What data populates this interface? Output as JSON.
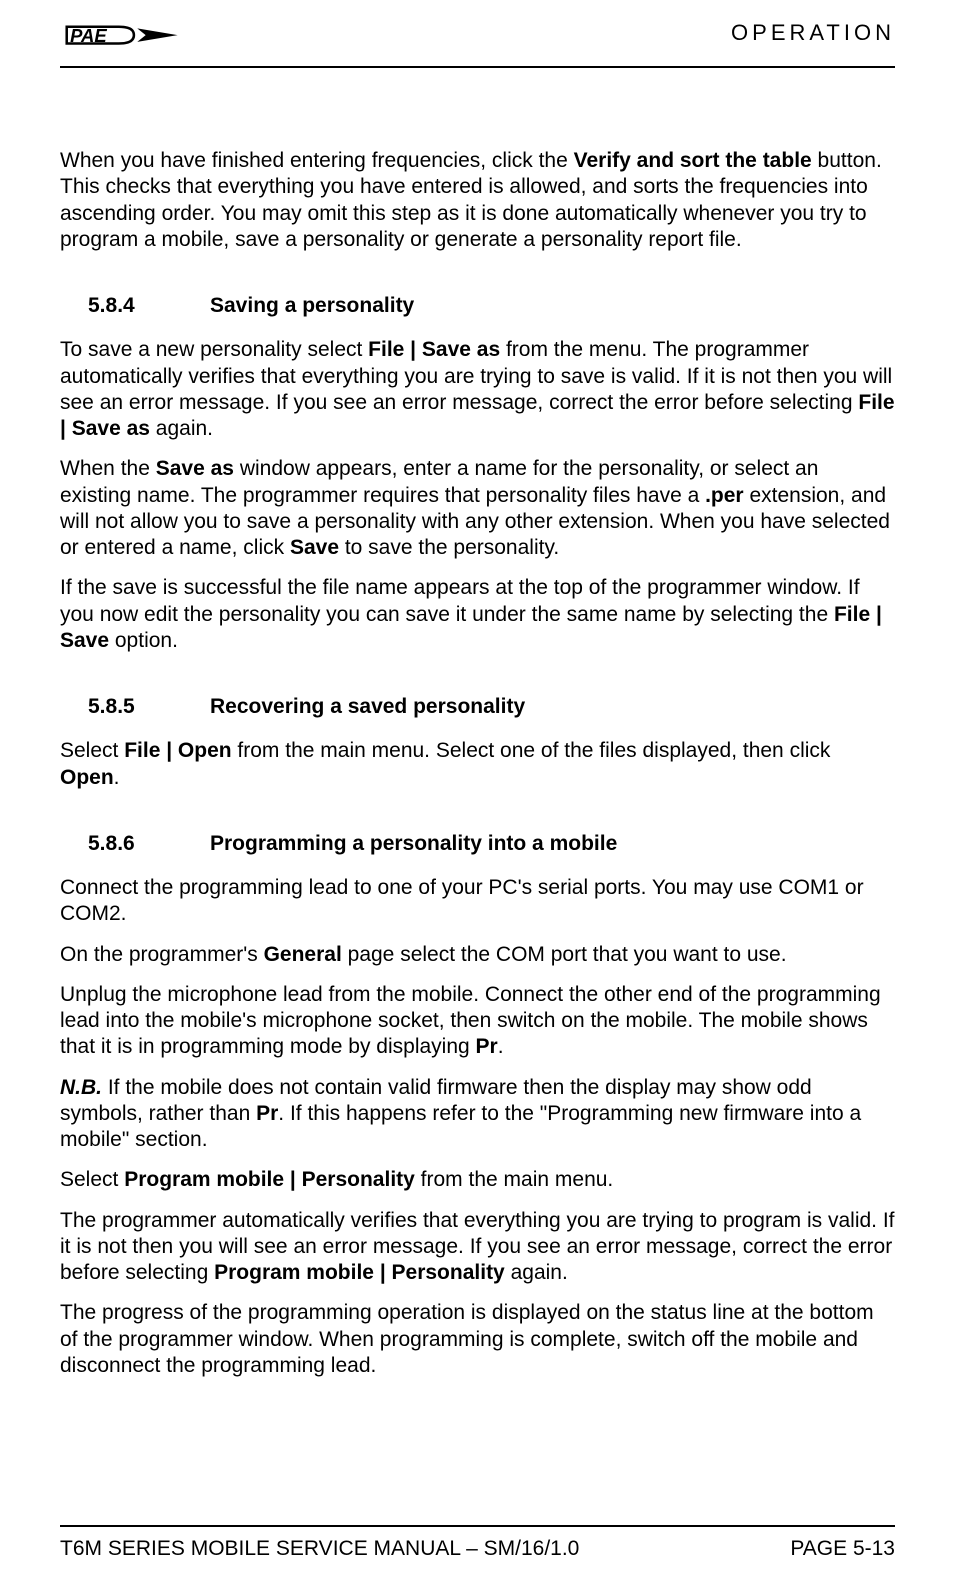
{
  "header": {
    "title": "OPERATION"
  },
  "intro_para_html": "When you have finished entering frequencies, click the <b>Verify and sort the table</b> button. This checks that everything you have entered is allowed, and sorts the frequencies into ascending order.  You may omit this step as it is done automatically whenever you try to program a mobile, save a personality or generate a personality report file.",
  "sections": [
    {
      "num": "5.8.4",
      "title": "Saving a personality",
      "paras_html": [
        "To save a new personality select <b>File | Save as</b> from the menu.  The programmer automatically verifies that everything you are trying to save is valid.  If it is not then you will see an error message.  If you see an error message, correct the error before selecting  <b>File | Save as</b> again.",
        "When the <b>Save as</b> window appears, enter a name for the personality, or select an existing name.  The programmer requires that personality files have a <b>.per</b> extension, and will not allow you to save a personality with any other extension.  When you have selected or entered a name, click <b>Save</b> to save the personality.",
        "If the save is successful the file name appears at the top of the programmer window. If you now edit the personality you can save it under the same name by selecting the <b>File | Save</b> option."
      ]
    },
    {
      "num": "5.8.5",
      "title": "Recovering a saved personality",
      "paras_html": [
        "Select <b>File | Open</b> from the main menu.  Select one of the files displayed, then click <b>Open</b>."
      ]
    },
    {
      "num": "5.8.6",
      "title": "Programming a personality into a mobile",
      "paras_html": [
        "Connect the programming lead to one of your PC's serial ports.  You may use COM1 or COM2.",
        "On the programmer's <b>General</b> page select the COM port that you want to use.",
        "Unplug the microphone lead from the mobile.  Connect the other end of the programming lead into the mobile's microphone socket, then switch on the mobile. The mobile shows that it is in programming mode by displaying <b>Pr</b>.",
        "<i class='nb'>N.B.</i> If the mobile does not contain valid firmware then the display may show odd symbols, rather than <b>Pr</b>.   If this happens refer to the \"Programming new firmware into a mobile\" section.",
        "Select <b>Program mobile | Personality</b> from the main menu.",
        "The programmer automatically verifies that everything you are trying to program is valid.  If it is not then you will see an error message.  If you see an error message, correct the error before selecting  <b>Program mobile | Personality</b> again.",
        "The progress of the programming operation is displayed on the status line at the bottom of the programmer window.  When programming is complete, switch off the mobile and disconnect the programming lead."
      ]
    }
  ],
  "footer": {
    "left": "T6M SERIES MOBILE SERVICE MANUAL – SM/16/1.0",
    "right": "PAGE 5-13"
  }
}
